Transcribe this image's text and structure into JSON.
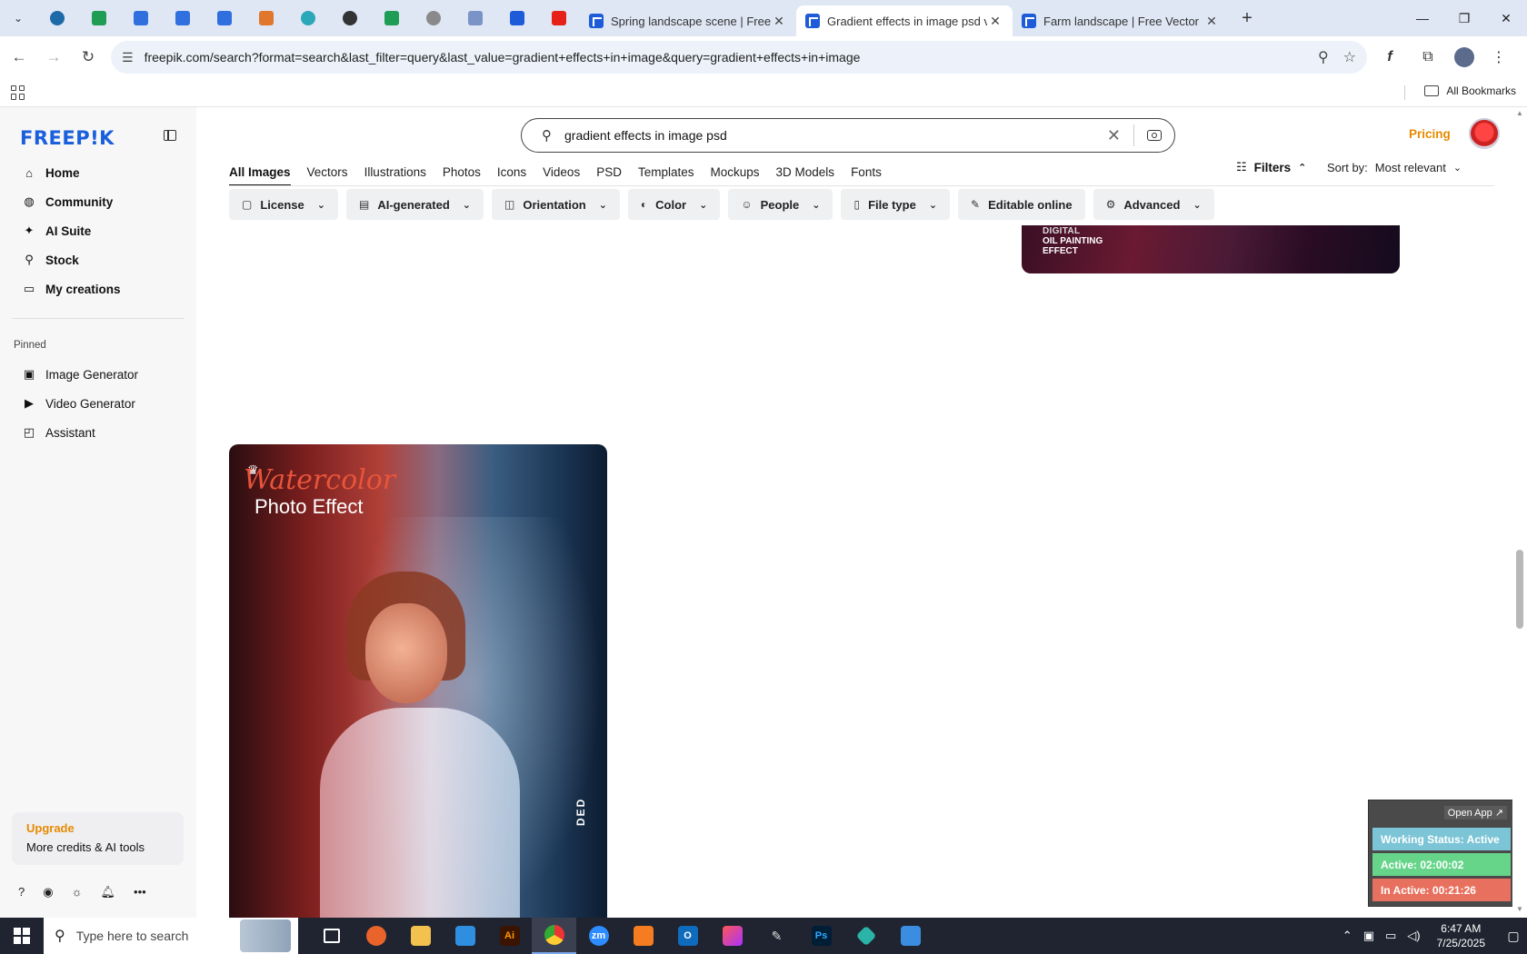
{
  "browser": {
    "tabs": [
      {
        "title": "Spring landscape scene | Free V",
        "active": false
      },
      {
        "title": "Gradient effects in image psd v",
        "active": true
      },
      {
        "title": "Farm landscape | Free Vector",
        "active": false
      }
    ],
    "url": "freepik.com/search?format=search&last_filter=query&last_value=gradient+effects+in+image&query=gradient+effects+in+image",
    "bookmarks_label": "All Bookmarks"
  },
  "sidebar": {
    "logo": "FREEP!K",
    "nav": [
      {
        "label": "Home",
        "icon": "home-icon"
      },
      {
        "label": "Community",
        "icon": "globe-icon"
      },
      {
        "label": "AI Suite",
        "icon": "sparkle-icon"
      },
      {
        "label": "Stock",
        "icon": "search-icon"
      },
      {
        "label": "My creations",
        "icon": "folder-icon"
      }
    ],
    "pinned_label": "Pinned",
    "pinned": [
      {
        "label": "Image Generator",
        "icon": "image-icon"
      },
      {
        "label": "Video Generator",
        "icon": "video-icon"
      },
      {
        "label": "Assistant",
        "icon": "chat-icon"
      }
    ],
    "upgrade_title": "Upgrade",
    "upgrade_subtitle": "More credits & AI tools"
  },
  "search": {
    "query": "gradient effects in image psd"
  },
  "header": {
    "pricing": "Pricing"
  },
  "categories": [
    "All Images",
    "Vectors",
    "Illustrations",
    "Photos",
    "Icons",
    "Videos",
    "PSD",
    "Templates",
    "Mockups",
    "3D Models",
    "Fonts"
  ],
  "filters_label": "Filters",
  "sort": {
    "label": "Sort by:",
    "value": "Most relevant"
  },
  "chips": [
    {
      "label": "License",
      "icon": "license-icon",
      "dropdown": true
    },
    {
      "label": "AI-generated",
      "icon": "ai-icon",
      "dropdown": true
    },
    {
      "label": "Orientation",
      "icon": "orientation-icon",
      "dropdown": true
    },
    {
      "label": "Color",
      "icon": "palette-icon",
      "dropdown": true
    },
    {
      "label": "People",
      "icon": "people-icon",
      "dropdown": true
    },
    {
      "label": "File type",
      "icon": "file-icon",
      "dropdown": true
    },
    {
      "label": "Editable online",
      "icon": "pen-icon",
      "dropdown": false
    },
    {
      "label": "Advanced",
      "icon": "gear-icon",
      "dropdown": true
    }
  ],
  "card_top": {
    "line1": "DIGITAL",
    "line2": "OIL PAINTING",
    "line3": "EFFECT"
  },
  "card_main": {
    "script": "Watercolor",
    "subtitle": "Photo Effect",
    "vertical_text": "DED"
  },
  "ext_widget": {
    "open": "Open App ↗",
    "status": "Working Status: Active",
    "active": "Active: 02:00:02",
    "inactive": "In Active: 00:21:26"
  },
  "taskbar": {
    "search_placeholder": "Type here to search",
    "time": "6:47 AM",
    "date": "7/25/2025"
  },
  "colors": {
    "accent": "#1a5fdb",
    "pricing": "#e68a00"
  }
}
